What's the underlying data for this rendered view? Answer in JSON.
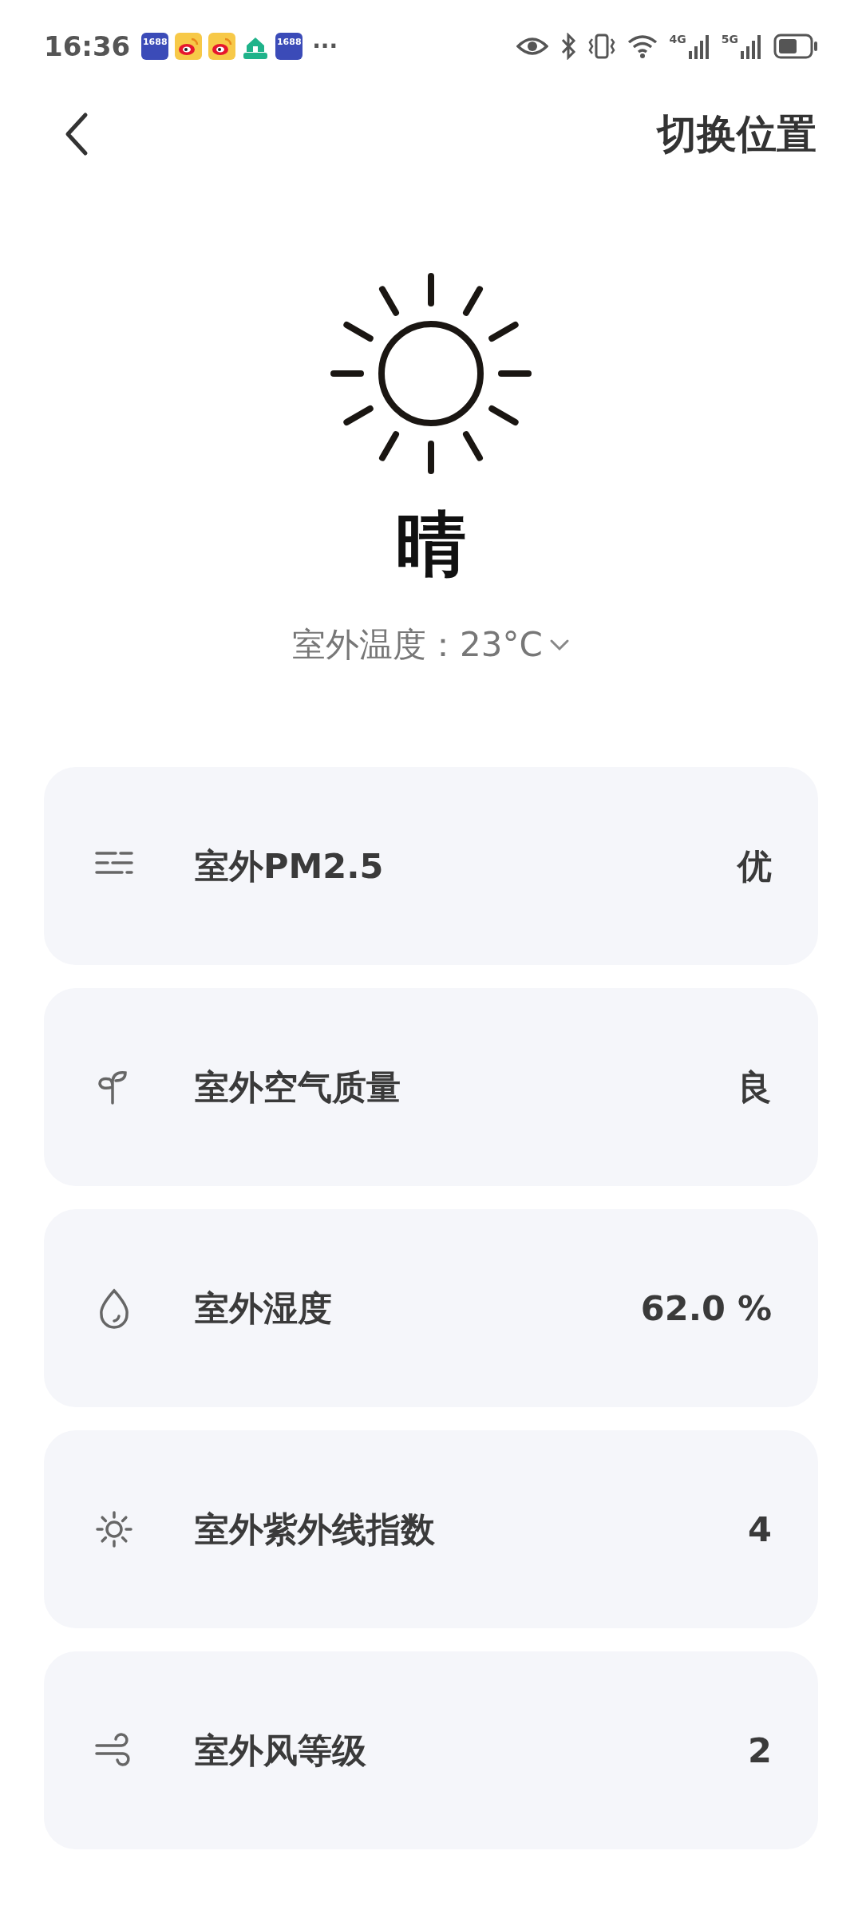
{
  "status_bar": {
    "time": "16:36",
    "notifications": [
      {
        "kind": "app",
        "label": "1688"
      },
      {
        "kind": "weibo"
      },
      {
        "kind": "weibo"
      },
      {
        "kind": "house"
      },
      {
        "kind": "app",
        "label": "1688"
      }
    ],
    "more": "···",
    "network_1": "4G",
    "network_2": "5G"
  },
  "header": {
    "title": "切换位置"
  },
  "weather": {
    "condition": "晴",
    "temperature": "室外温度：23°C"
  },
  "items": [
    {
      "kind": "pm",
      "label": "室外PM2.5",
      "value": "优"
    },
    {
      "kind": "air",
      "label": "室外空气质量",
      "value": "良"
    },
    {
      "kind": "humidity",
      "label": "室外湿度",
      "value": "62.0 %"
    },
    {
      "kind": "uv",
      "label": "室外紫外线指数",
      "value": "4"
    },
    {
      "kind": "wind",
      "label": "室外风等级",
      "value": "2"
    }
  ]
}
